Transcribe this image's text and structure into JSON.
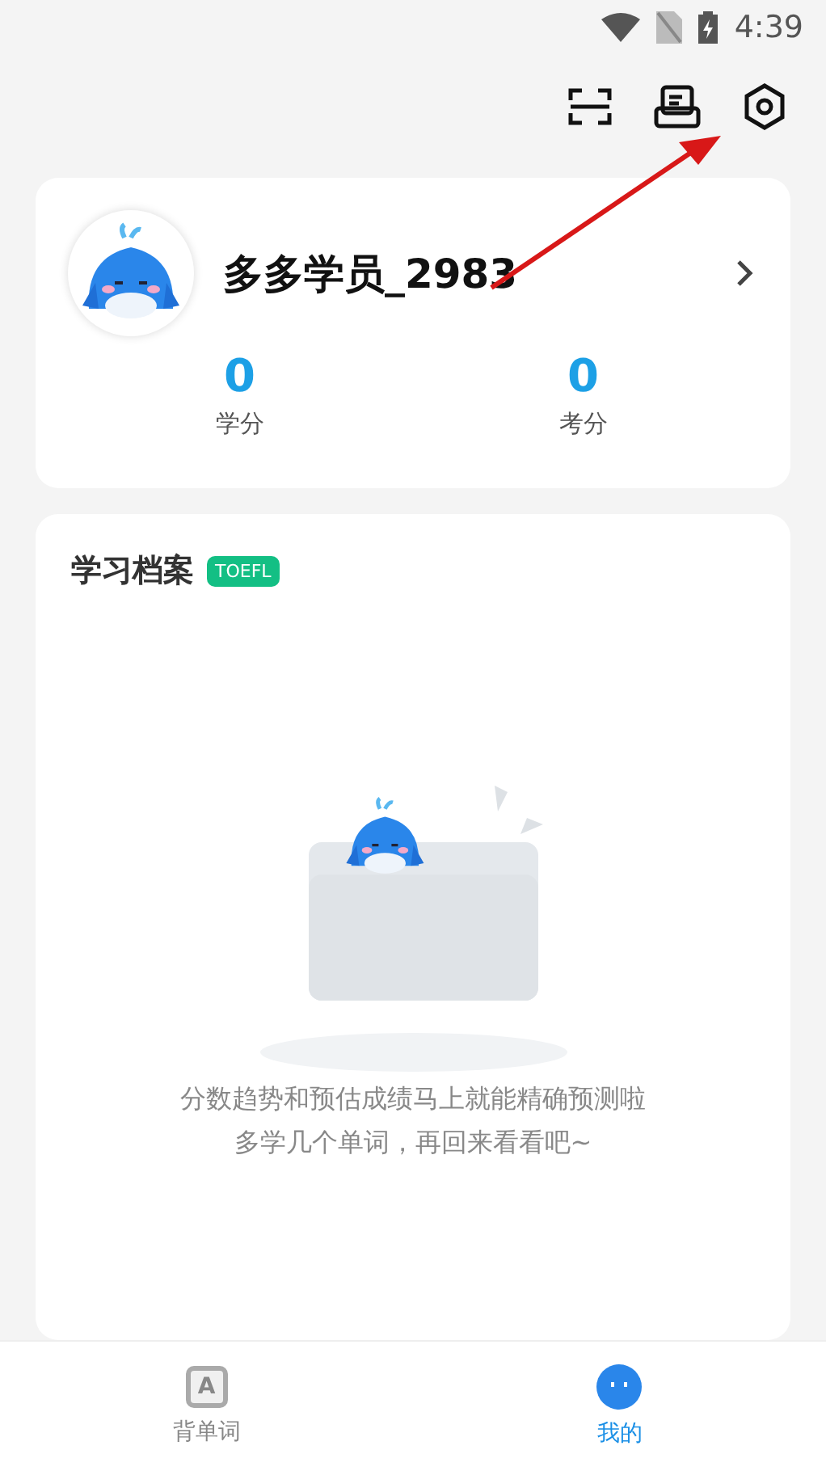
{
  "status_bar": {
    "time": "4:39"
  },
  "toolbar": {
    "actions": [
      {
        "kind": "scan"
      },
      {
        "kind": "records"
      },
      {
        "kind": "settings"
      }
    ]
  },
  "profile": {
    "name": "多多学员_2983",
    "stats": [
      {
        "value": "0",
        "label": "学分"
      },
      {
        "value": "0",
        "label": "考分"
      }
    ]
  },
  "archive": {
    "title": "学习档案",
    "tag": "TOEFL",
    "empty_lines": [
      "分数趋势和预估成绩马上就能精确预测啦",
      "多学几个单词，再回来看看吧~"
    ]
  },
  "tab_bar": {
    "tabs": [
      {
        "label": "背单词",
        "icon_text": "A",
        "selected": false
      },
      {
        "label": "我的",
        "selected": true
      }
    ]
  }
}
